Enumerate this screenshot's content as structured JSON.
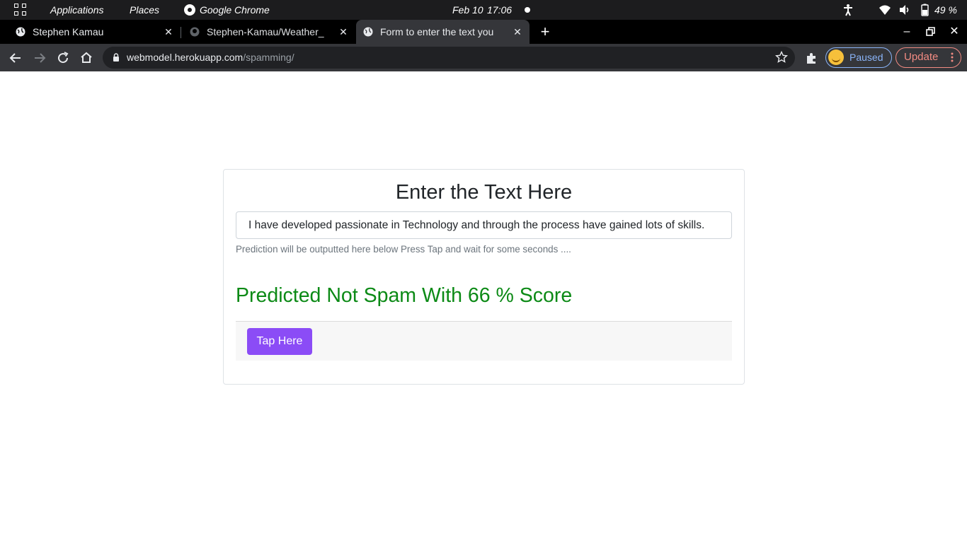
{
  "system_bar": {
    "applications": "Applications",
    "places": "Places",
    "active_app": "Google Chrome",
    "date": "Feb 10",
    "time": "17:06",
    "battery": "49 %"
  },
  "tabs": [
    {
      "title": "Stephen Kamau",
      "favicon": "globe-icon",
      "active": false
    },
    {
      "title": "Stephen-Kamau/Weather_",
      "favicon": "github-icon",
      "active": false
    },
    {
      "title": "Form to enter the text you",
      "favicon": "globe-icon",
      "active": true
    }
  ],
  "toolbar": {
    "url_host": "webmodel.herokuapp.com",
    "url_path": "/spamming/",
    "profile_label": "Paused",
    "update_label": "Update"
  },
  "page": {
    "heading": "Enter the Text Here",
    "input_value": "I have developed passionate in Technology and through the process have gained lots of skills.",
    "help_text": "Prediction will be outputted here below Press Tap and wait for some seconds ....",
    "prediction": "Predicted Not Spam With 66 % Score",
    "button_label": "Tap Here"
  },
  "colors": {
    "prediction": "#0c8a16",
    "button": "#8b4cf6",
    "profile_accent": "#8ab4f8",
    "update_accent": "#f28b82"
  }
}
